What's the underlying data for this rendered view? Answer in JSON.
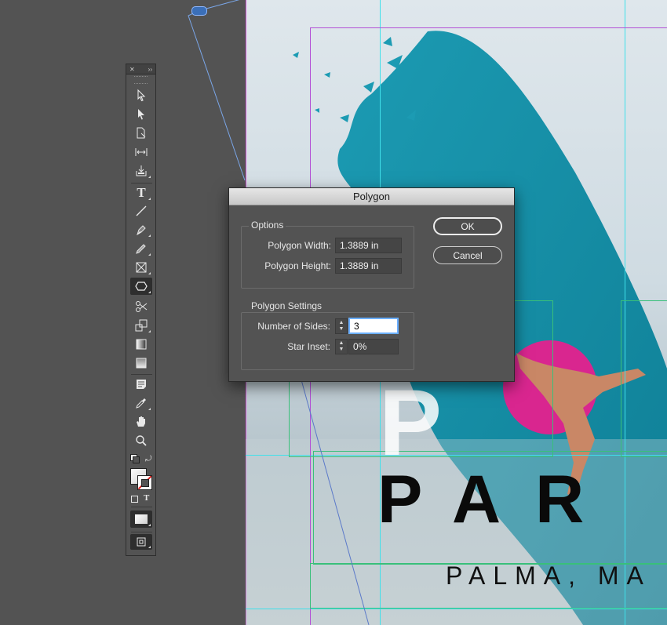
{
  "dialog": {
    "title": "Polygon",
    "options_group": "Options",
    "width_label": "Polygon Width:",
    "width_value": "1.3889 in",
    "height_label": "Polygon Height:",
    "height_value": "1.3889 in",
    "settings_group": "Polygon Settings",
    "sides_label": "Number of Sides:",
    "sides_value": "3",
    "inset_label": "Star Inset:",
    "inset_value": "0%",
    "ok_label": "OK",
    "cancel_label": "Cancel"
  },
  "tools": {
    "header_close": "✕",
    "header_collapse": "››",
    "text_tool_glyph": "T",
    "stroke_text_glyph": "T"
  },
  "page": {
    "big_letter": "P",
    "headline": "PAR",
    "subheadline": "PALMA, MA"
  },
  "colors": {
    "brush": "#1593ab",
    "ball": "#d9268f",
    "guide": "#3fe0ea",
    "margin": "#b34fd6"
  },
  "icons": [
    "selection-icon",
    "direct-selection-icon",
    "page-tool-icon",
    "gap-tool-icon",
    "content-collector-icon",
    "type-icon",
    "line-icon",
    "pen-icon",
    "pencil-icon",
    "rectangle-frame-icon",
    "polygon-icon",
    "scissors-icon",
    "free-transform-icon",
    "gradient-swatch-icon",
    "gradient-feather-icon",
    "note-icon",
    "eyedropper-icon",
    "hand-icon",
    "zoom-icon"
  ]
}
